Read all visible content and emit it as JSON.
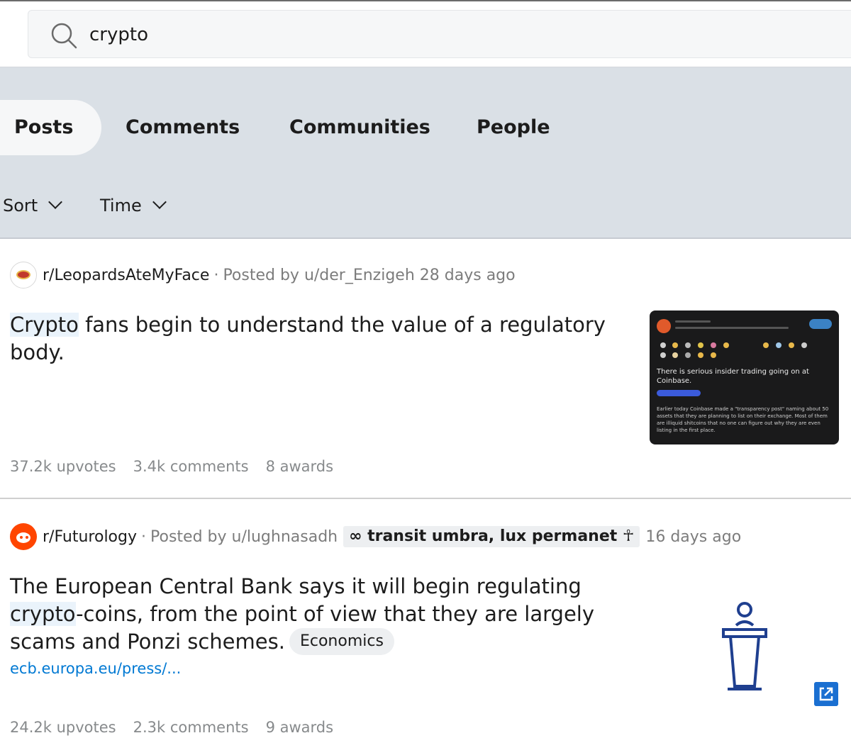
{
  "search": {
    "query": "crypto",
    "icon": "search-icon"
  },
  "tabs": [
    {
      "label": "Posts",
      "active": true
    },
    {
      "label": "Comments",
      "active": false
    },
    {
      "label": "Communities",
      "active": false
    },
    {
      "label": "People",
      "active": false
    }
  ],
  "filters": {
    "sort_label": "Sort",
    "time_label": "Time"
  },
  "posts": [
    {
      "subreddit": "r/LeopardsAteMyFace",
      "separator": "·",
      "posted_by": "Posted by u/der_Enzigeh",
      "age": "28 days ago",
      "title_highlight": "Crypto",
      "title_rest": " fans begin to understand the value of a regulatory body.",
      "thumbnail": {
        "title": "There is serious insider trading going on at Coinbase.",
        "body": "Earlier today Coinbase made a \"transparency post\" naming about 50 assets that they are planning to list on their exchange. Most of them are illiquid shitcoins that no one can figure out why they are even listing in the first place."
      },
      "upvotes": "37.2k upvotes",
      "comments": "3.4k comments",
      "awards": "8 awards"
    },
    {
      "subreddit": "r/Futurology",
      "separator": "·",
      "posted_by": "Posted by u/lughnasadh",
      "user_flair": "∞ transit umbra, lux permanet ☥",
      "age": "16 days ago",
      "title_before": "The European Central Bank says it will begin regulating ",
      "title_highlight": "crypto",
      "title_after": "-coins, from the point of view that they are largely scams and Ponzi schemes.",
      "tag": "Economics",
      "link": "ecb.europa.eu/press/...",
      "upvotes": "24.2k upvotes",
      "comments": "2.3k comments",
      "awards": "9 awards"
    }
  ],
  "colors": {
    "panel_bg": "#dae0e6",
    "link_blue": "#0079d3",
    "highlight": "#eaf3fb",
    "futurology_orange": "#ff4500"
  }
}
